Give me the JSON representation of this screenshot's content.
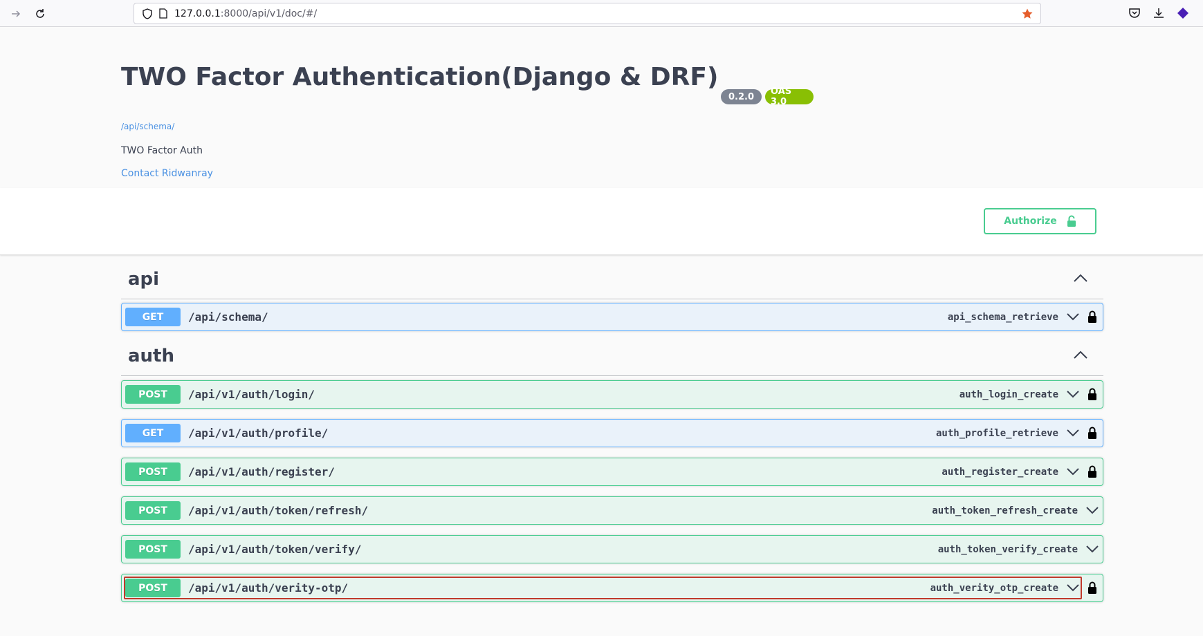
{
  "browser": {
    "url_host": "127.0.0.1",
    "url_rest": ":8000/api/v1/doc/#/"
  },
  "info": {
    "title": "TWO Factor Authentication(Django & DRF)",
    "version_badge": "0.2.0",
    "oas_badge": "OAS 3.0",
    "schema_link": "/api/schema/",
    "description": "TWO Factor Auth",
    "contact": "Contact Ridwanray"
  },
  "scheme": {
    "authorize_label": "Authorize"
  },
  "tags": [
    {
      "name": "api",
      "operations": [
        {
          "method": "GET",
          "path": "/api/schema/",
          "operation_id": "api_schema_retrieve",
          "locked": true
        }
      ]
    },
    {
      "name": "auth",
      "operations": [
        {
          "method": "POST",
          "path": "/api/v1/auth/login/",
          "operation_id": "auth_login_create",
          "locked": true
        },
        {
          "method": "GET",
          "path": "/api/v1/auth/profile/",
          "operation_id": "auth_profile_retrieve",
          "locked": true
        },
        {
          "method": "POST",
          "path": "/api/v1/auth/register/",
          "operation_id": "auth_register_create",
          "locked": true
        },
        {
          "method": "POST",
          "path": "/api/v1/auth/token/refresh/",
          "operation_id": "auth_token_refresh_create",
          "locked": false
        },
        {
          "method": "POST",
          "path": "/api/v1/auth/token/verify/",
          "operation_id": "auth_token_verify_create",
          "locked": false
        },
        {
          "method": "POST",
          "path": "/api/v1/auth/verity-otp/",
          "operation_id": "auth_verity_otp_create",
          "locked": true,
          "focused": true
        }
      ]
    }
  ],
  "colors": {
    "get": "#61affe",
    "post": "#49cc90",
    "link": "#4990e2",
    "focus": "#c0392b"
  }
}
